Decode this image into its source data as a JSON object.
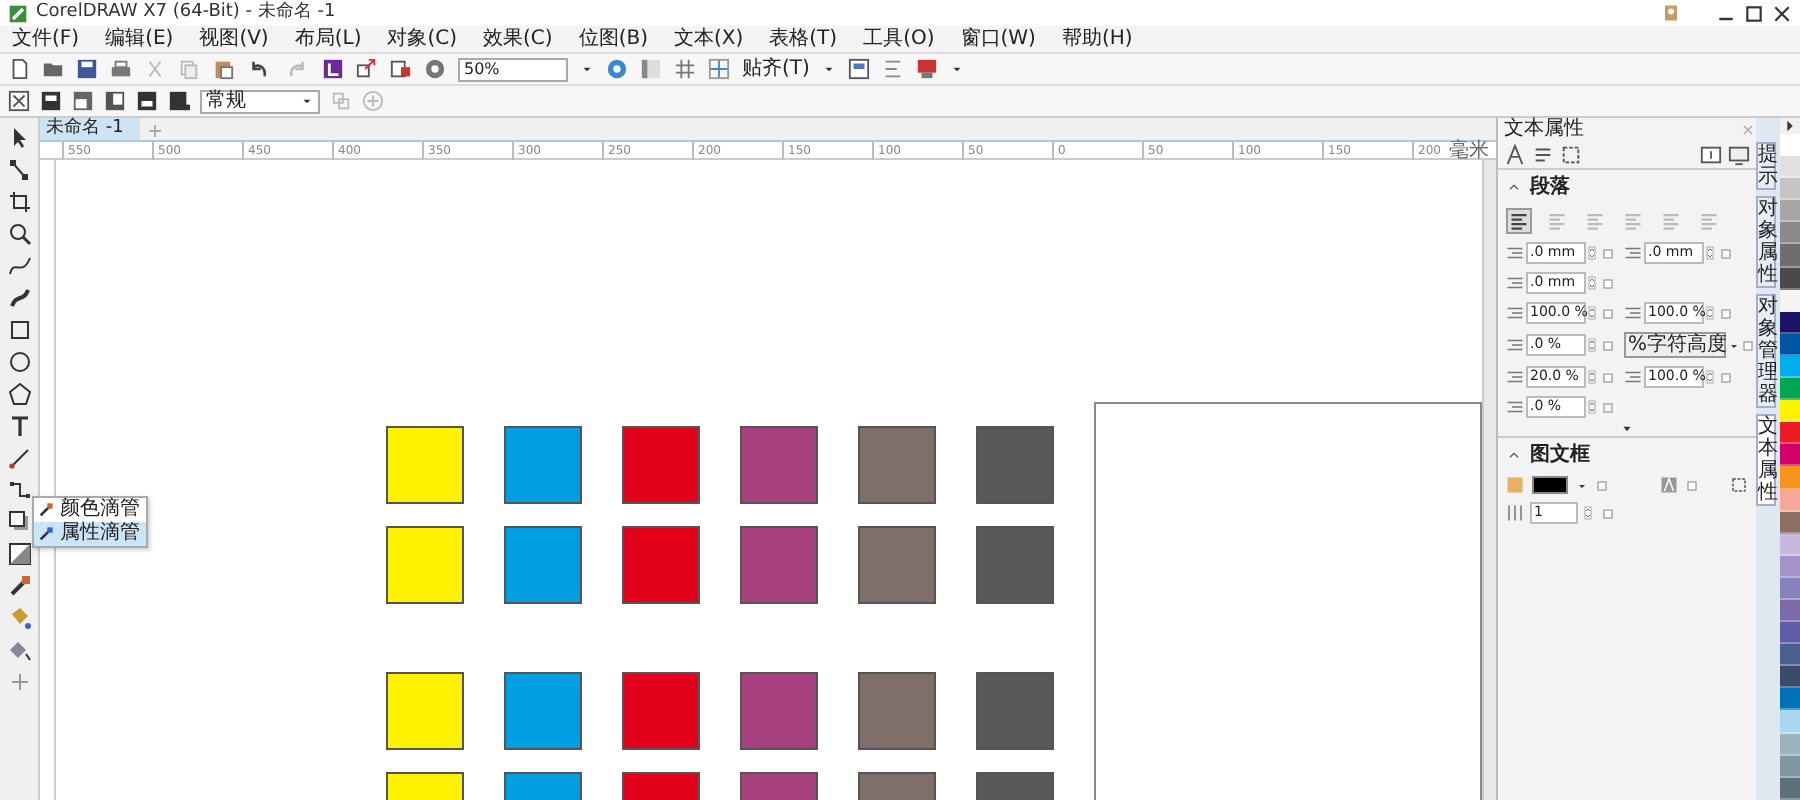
{
  "window": {
    "title": "CorelDRAW X7 (64-Bit) - 未命名 -1"
  },
  "menu": [
    "文件(F)",
    "编辑(E)",
    "视图(V)",
    "布局(L)",
    "对象(C)",
    "效果(C)",
    "位图(B)",
    "文本(X)",
    "表格(T)",
    "工具(O)",
    "窗口(W)",
    "帮助(H)"
  ],
  "toolbar": {
    "zoom": "50%",
    "snap": "贴齐(T)"
  },
  "property_bar": {
    "style_dropdown": "常规"
  },
  "document_tabs": [
    {
      "label": "未命名 -1",
      "selected": true
    }
  ],
  "ruler": {
    "labels": [
      "550",
      "500",
      "450",
      "400",
      "350",
      "300",
      "250",
      "200",
      "150",
      "100",
      "50",
      "0",
      "50",
      "100",
      "150",
      "200"
    ],
    "unit": "毫米"
  },
  "flyout": [
    {
      "label": "颜色滴管",
      "selected": false
    },
    {
      "label": "属性滴管",
      "selected": true
    }
  ],
  "canvas": {
    "swatch_groups": [
      [
        [
          {
            "color": "#fff100"
          },
          {
            "color": "#009fe3"
          },
          {
            "color": "#e3001b"
          },
          {
            "color": "#a8407f"
          },
          {
            "color": "#7f6f68"
          },
          {
            "color": "#585856"
          }
        ],
        [
          {
            "color": "#fff100"
          },
          {
            "color": "#009fe3"
          },
          {
            "color": "#e3001b"
          },
          {
            "color": "#a8407f"
          },
          {
            "color": "#7f6f68"
          },
          {
            "color": "#585856"
          }
        ]
      ],
      [
        [
          {
            "color": "#fff100"
          },
          {
            "color": "#009fe3"
          },
          {
            "color": "#e3001b"
          },
          {
            "color": "#a8407f"
          },
          {
            "color": "#7f6f68"
          },
          {
            "color": "#585856"
          }
        ],
        [
          {
            "color": "#fff100"
          },
          {
            "color": "#009fe3"
          },
          {
            "color": "#e3001b"
          },
          {
            "color": "#a8407f"
          },
          {
            "color": "#7f6f68"
          },
          {
            "color": "#585856"
          }
        ]
      ]
    ]
  },
  "docker": {
    "title": "文本属性",
    "paragraph": {
      "title": "段落",
      "expanded": true,
      "alignment_buttons": [
        {
          "selected": true
        },
        {
          "selected": false
        },
        {
          "selected": false
        },
        {
          "selected": false
        },
        {
          "selected": false
        },
        {
          "selected": false
        }
      ],
      "rows": [
        [
          {
            "kind": "spin",
            "value": ".0 mm"
          },
          {
            "kind": "spin",
            "value": ".0 mm"
          }
        ],
        [
          {
            "kind": "spin",
            "value": ".0 mm"
          }
        ],
        [
          {
            "kind": "spin",
            "value": "100.0 %"
          },
          {
            "kind": "spin",
            "value": "100.0 %"
          }
        ],
        [
          {
            "kind": "spin",
            "value": ".0 %"
          },
          {
            "kind": "dropdown",
            "value": "%字符高度"
          }
        ],
        [
          {
            "kind": "spin",
            "value": "20.0 %"
          },
          {
            "kind": "spin",
            "value": "100.0 %"
          }
        ],
        [
          {
            "kind": "spin",
            "value": ".0 %"
          }
        ]
      ]
    },
    "frame": {
      "title": "图文框",
      "expanded": true,
      "columns": "1"
    }
  },
  "docker_tabs": [
    {
      "label": "提示",
      "selected": false
    },
    {
      "label": "对象属性",
      "selected": false
    },
    {
      "label": "对象管理器",
      "selected": false
    },
    {
      "label": "文本属性",
      "selected": true
    }
  ],
  "palette": [
    {
      "color": "#ffffff"
    },
    {
      "color": "#e0e0e0"
    },
    {
      "color": "#c4c4c4"
    },
    {
      "color": "#a6a6a6"
    },
    {
      "color": "#8a8a8a"
    },
    {
      "color": "#6e6e6e"
    },
    {
      "color": "#4a4a4a"
    },
    {
      "color": "#f4f4f4"
    },
    {
      "color": "#1b1464"
    },
    {
      "color": "#0054a6"
    },
    {
      "color": "#00aeef"
    },
    {
      "color": "#00a651"
    },
    {
      "color": "#fff200"
    },
    {
      "color": "#ed1c24"
    },
    {
      "color": "#d4006a"
    },
    {
      "color": "#f7941d"
    },
    {
      "color": "#f5a89a"
    },
    {
      "color": "#8c6e63"
    },
    {
      "color": "#c9b8dd"
    },
    {
      "color": "#a393c8"
    },
    {
      "color": "#8781bd"
    },
    {
      "color": "#7a6ba8"
    },
    {
      "color": "#605ca8"
    },
    {
      "color": "#4b5f8f"
    },
    {
      "color": "#3b4a6b"
    },
    {
      "color": "#0072bc"
    },
    {
      "color": "#a7d8f0"
    },
    {
      "color": "#9bb4c0"
    },
    {
      "color": "#7f96a3"
    },
    {
      "color": "#5c6f7a"
    }
  ]
}
